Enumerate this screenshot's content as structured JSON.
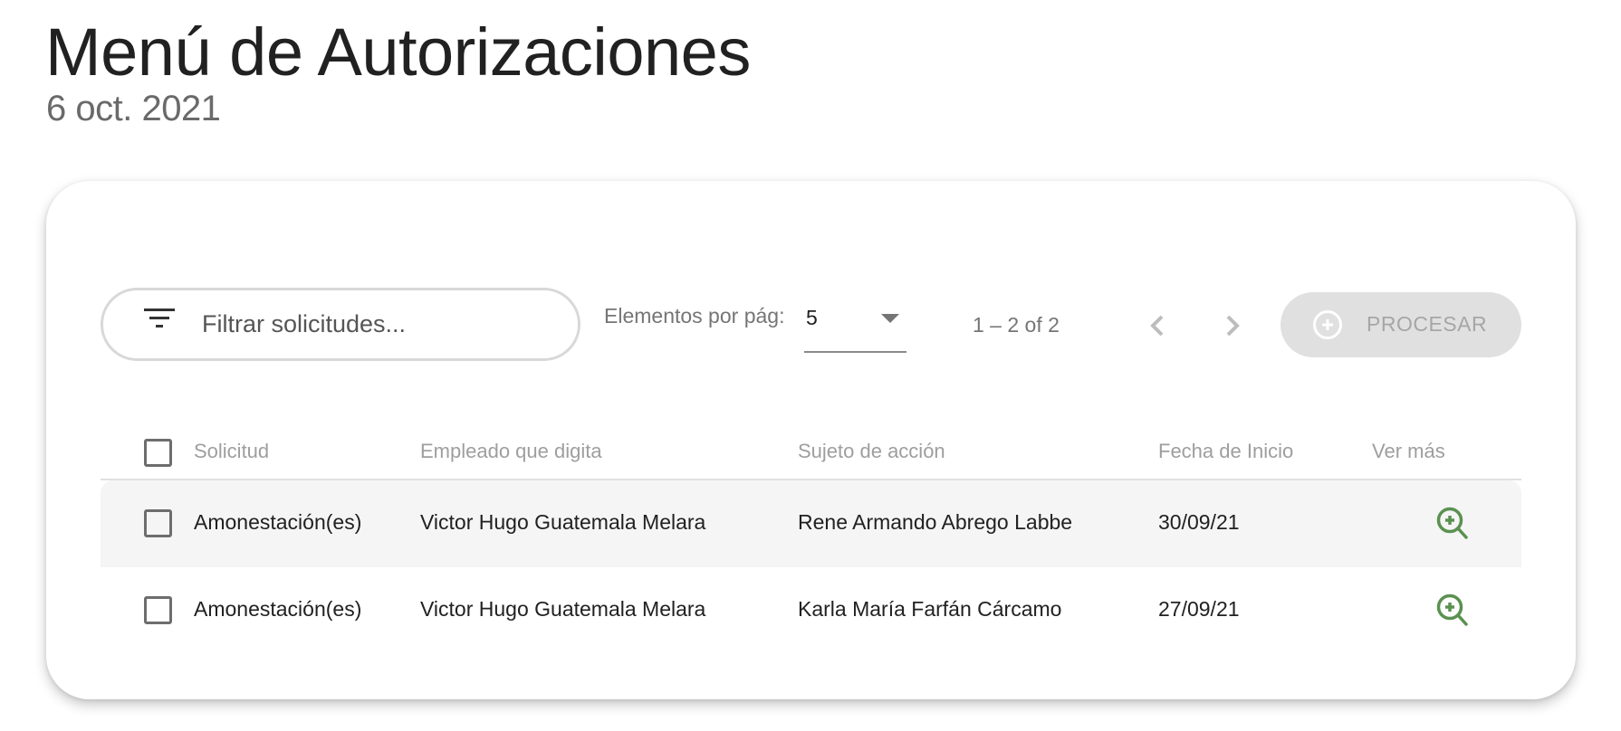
{
  "header": {
    "title": "Menú de Autorizaciones",
    "date": "6 oct. 2021"
  },
  "toolbar": {
    "filter": {
      "icon": "filter-list-icon",
      "placeholder": "Filtrar solicitudes...",
      "value": ""
    },
    "paginator": {
      "per_page_label": "Elementos por pág:",
      "per_page_value": "5",
      "range_label": "1 – 2 of 2",
      "prev_icon": "chevron-left-icon",
      "next_icon": "chevron-right-icon"
    },
    "process_button": {
      "label": "PROCESAR",
      "icon": "add-circle-outline-icon",
      "disabled": true
    }
  },
  "table": {
    "columns": [
      "Solicitud",
      "Empleado que digita",
      "Sujeto de acción",
      "Fecha de Inicio",
      "Ver más"
    ],
    "rows": [
      {
        "solicitud": "Amonestación(es)",
        "empleado": "Victor Hugo Guatemala Melara",
        "sujeto": "Rene Armando Abrego Labbe",
        "fecha": "30/09/21",
        "ver_mas_icon": "zoom-in-icon"
      },
      {
        "solicitud": "Amonestación(es)",
        "empleado": "Victor Hugo Guatemala Melara",
        "sujeto": "Karla María Farfán Cárcamo",
        "fecha": "27/09/21",
        "ver_mas_icon": "zoom-in-icon"
      }
    ]
  },
  "colors": {
    "accent_green": "#5a9150",
    "disabled_button_bg": "#e0e0e0",
    "disabled_button_text": "#a6a6a6",
    "row_highlight": "#f5f5f5"
  }
}
